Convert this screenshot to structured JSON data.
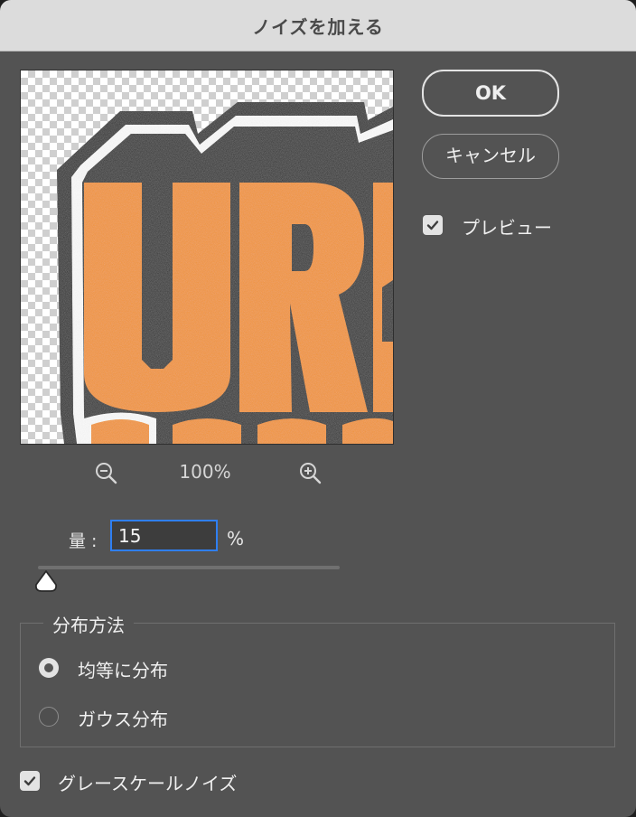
{
  "window": {
    "title": "ノイズを加える"
  },
  "preview": {
    "artwork_text": "URB",
    "colors": {
      "orange": "#F7931E",
      "black": "#141414",
      "white": "#FFFFFF"
    }
  },
  "zoom": {
    "level": "100%",
    "zoom_out_icon": "zoom-out-icon",
    "zoom_in_icon": "zoom-in-icon"
  },
  "buttons": {
    "ok": "OK",
    "cancel": "キャンセル"
  },
  "preview_toggle": {
    "label": "プレビュー",
    "checked": true
  },
  "amount": {
    "label": "量 :",
    "value": "15",
    "unit": "%",
    "slider_fraction": 0.0375
  },
  "distribution": {
    "title": "分布方法",
    "options": [
      {
        "label": "均等に分布",
        "selected": true
      },
      {
        "label": "ガウス分布",
        "selected": false
      }
    ]
  },
  "grayscale": {
    "label": "グレースケールノイズ",
    "checked": true
  },
  "colors": {
    "dialog_bg": "#535353",
    "titlebar_bg": "#DCDCDC",
    "focus_blue": "#2F7FF2",
    "control_light": "#E3E3E3"
  }
}
